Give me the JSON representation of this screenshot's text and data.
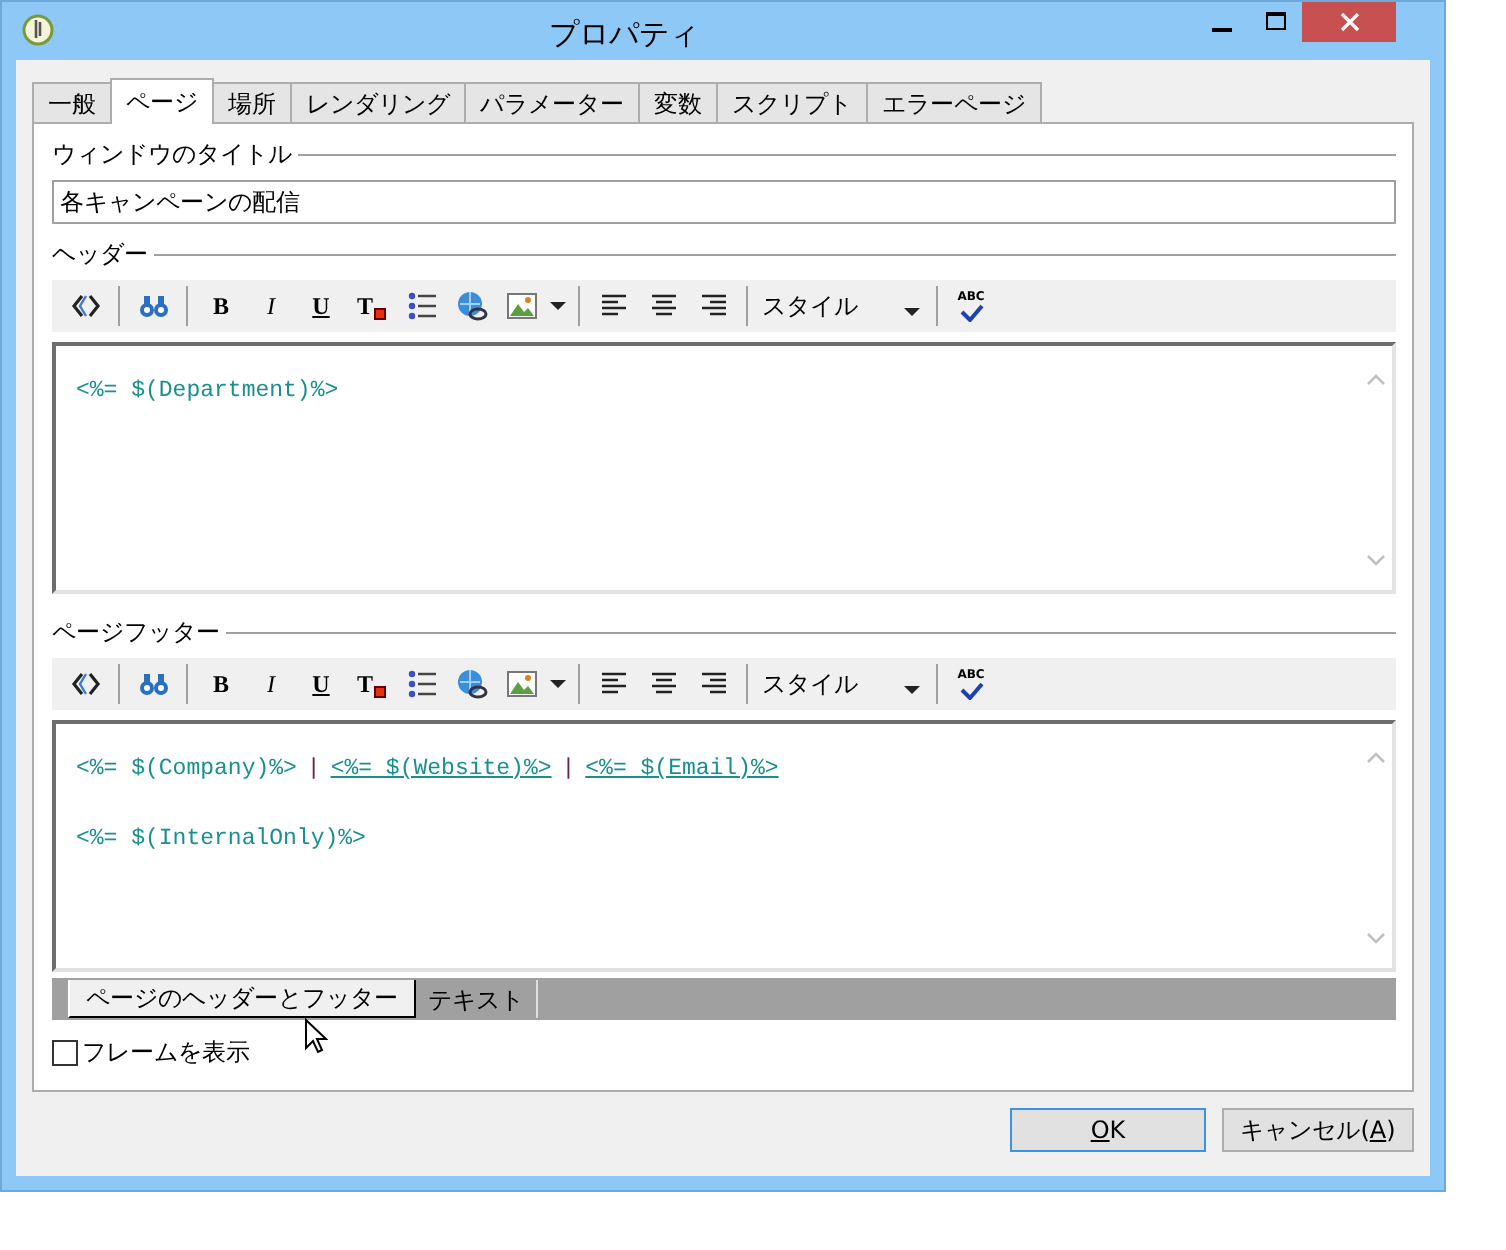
{
  "window": {
    "title": "プロパティ"
  },
  "tabs": [
    {
      "label": "一般",
      "selected": false
    },
    {
      "label": "ページ",
      "selected": true
    },
    {
      "label": "場所",
      "selected": false
    },
    {
      "label": "レンダリング",
      "selected": false
    },
    {
      "label": "パラメーター",
      "selected": false
    },
    {
      "label": "変数",
      "selected": false
    },
    {
      "label": "スクリプト",
      "selected": false
    },
    {
      "label": "エラーページ",
      "selected": false
    }
  ],
  "window_title_field": {
    "label": "ウィンドウのタイトル",
    "value": "各キャンペーンの配信"
  },
  "editors": [
    {
      "label": "ヘッダー",
      "toolbar": [
        {
          "kind": "source"
        },
        {
          "kind": "separator"
        },
        {
          "kind": "find"
        },
        {
          "kind": "separator"
        },
        {
          "kind": "bold",
          "label": "B"
        },
        {
          "kind": "italic",
          "label": "I"
        },
        {
          "kind": "underline",
          "label": "U"
        },
        {
          "kind": "text-color",
          "label": "T"
        },
        {
          "kind": "list"
        },
        {
          "kind": "link"
        },
        {
          "kind": "image"
        },
        {
          "kind": "dropdown"
        },
        {
          "kind": "separator"
        },
        {
          "kind": "align-left"
        },
        {
          "kind": "align-center"
        },
        {
          "kind": "align-right"
        },
        {
          "kind": "separator"
        },
        {
          "kind": "style",
          "label": "スタイル"
        },
        {
          "kind": "separator"
        },
        {
          "kind": "spellcheck",
          "label": "ABC"
        }
      ],
      "lines": [
        [
          {
            "kind": "text",
            "text": "<%= $(Department)%>"
          }
        ]
      ]
    },
    {
      "label": "ページフッター",
      "toolbar": [
        {
          "kind": "source"
        },
        {
          "kind": "separator"
        },
        {
          "kind": "find"
        },
        {
          "kind": "separator"
        },
        {
          "kind": "bold",
          "label": "B"
        },
        {
          "kind": "italic",
          "label": "I"
        },
        {
          "kind": "underline",
          "label": "U"
        },
        {
          "kind": "text-color",
          "label": "T"
        },
        {
          "kind": "list"
        },
        {
          "kind": "link"
        },
        {
          "kind": "image"
        },
        {
          "kind": "dropdown"
        },
        {
          "kind": "separator"
        },
        {
          "kind": "align-left"
        },
        {
          "kind": "align-center"
        },
        {
          "kind": "align-right"
        },
        {
          "kind": "separator"
        },
        {
          "kind": "style",
          "label": "スタイル"
        },
        {
          "kind": "separator"
        },
        {
          "kind": "spellcheck",
          "label": "ABC"
        }
      ],
      "lines": [
        [
          {
            "kind": "text",
            "text": "<%= $(Company)%>"
          },
          {
            "kind": "separator",
            "text": "|"
          },
          {
            "kind": "link",
            "text": "<%= $(Website)%>"
          },
          {
            "kind": "separator",
            "text": "|"
          },
          {
            "kind": "link",
            "text": "<%= $(Email)%>"
          }
        ],
        [
          {
            "kind": "text",
            "text": "<%= $(InternalOnly)%>"
          }
        ]
      ]
    }
  ],
  "bottom_tabs": [
    {
      "label": "ページのヘッダーとフッター",
      "selected": true
    },
    {
      "label": "テキスト",
      "selected": false
    }
  ],
  "show_frame": {
    "label": "フレームを表示",
    "checked": false
  },
  "buttons": [
    {
      "key": "O",
      "after": "K",
      "default": true
    },
    {
      "before": "キャンセル(",
      "key": "A",
      "after": ")",
      "default": false
    }
  ]
}
